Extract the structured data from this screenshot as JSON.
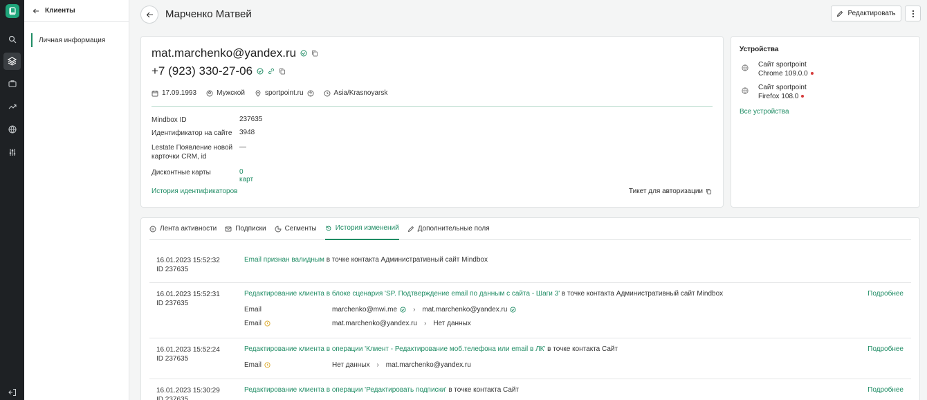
{
  "nav": {
    "back_label": "Клиенты",
    "items": [
      {
        "label": "Личная информация"
      }
    ]
  },
  "header": {
    "title": "Марченко Матвей",
    "edit_label": "Редактировать"
  },
  "profile": {
    "email": "mat.marchenko@yandex.ru",
    "phone": "+7 (923) 330-27-06",
    "birthdate": "17.09.1993",
    "gender": "Мужской",
    "site": "sportpoint.ru",
    "timezone": "Asia/Krasnoyarsk",
    "fields": [
      {
        "label": "Mindbox ID",
        "value": "237635"
      },
      {
        "label": "Идентификатор на сайте",
        "value": "3948"
      },
      {
        "label": "Lestate Появление новой карточки CRM, id",
        "value": "—"
      },
      {
        "label": "Дисконтные карты",
        "value": "0 карт"
      }
    ],
    "history_link": "История идентификаторов",
    "ticket_label": "Тикет для авторизации"
  },
  "devices": {
    "title": "Устройства",
    "items": [
      {
        "name": "Сайт sportpoint",
        "browser": "Chrome 109.0.0"
      },
      {
        "name": "Сайт sportpoint",
        "browser": "Firefox 108.0"
      }
    ],
    "all_link": "Все устройства"
  },
  "tabs": [
    {
      "label": "Лента активности"
    },
    {
      "label": "Подписки"
    },
    {
      "label": "Сегменты"
    },
    {
      "label": "История изменений"
    },
    {
      "label": "Дополнительные поля"
    }
  ],
  "history": {
    "more_label": "Подробнее",
    "entries": [
      {
        "time": "16.01.2023 15:52:32",
        "id": "ID 237635",
        "link": "Email признан валидным",
        "rest": " в точке контакта Административный сайт Mindbox"
      },
      {
        "time": "16.01.2023 15:52:31",
        "id": "ID 237635",
        "link": "Редактирование клиента в блоке сценария 'SP. Подтверждение email по данным с сайта - Шаги 3'",
        "rest": " в точке контакта Административный сайт Mindbox",
        "changes": [
          {
            "field": "Email",
            "old": "marchenko@mwi.me",
            "new": "mat.marchenko@yandex.ru"
          },
          {
            "field": "Email",
            "old": "mat.marchenko@yandex.ru",
            "new": "Нет данных"
          }
        ]
      },
      {
        "time": "16.01.2023 15:52:24",
        "id": "ID 237635",
        "link": "Редактирование клиента в операции 'Клиент - Редактирование моб.телефона или email в ЛК'",
        "rest": " в точке контакта Сайт",
        "changes": [
          {
            "field": "Email",
            "old": "Нет данных",
            "new": "mat.marchenko@yandex.ru"
          }
        ]
      },
      {
        "time": "16.01.2023 15:30:29",
        "id": "ID 237635",
        "link": "Редактирование клиента в операции 'Редактировать подписки'",
        "rest": " в точке контакта Сайт"
      }
    ]
  }
}
